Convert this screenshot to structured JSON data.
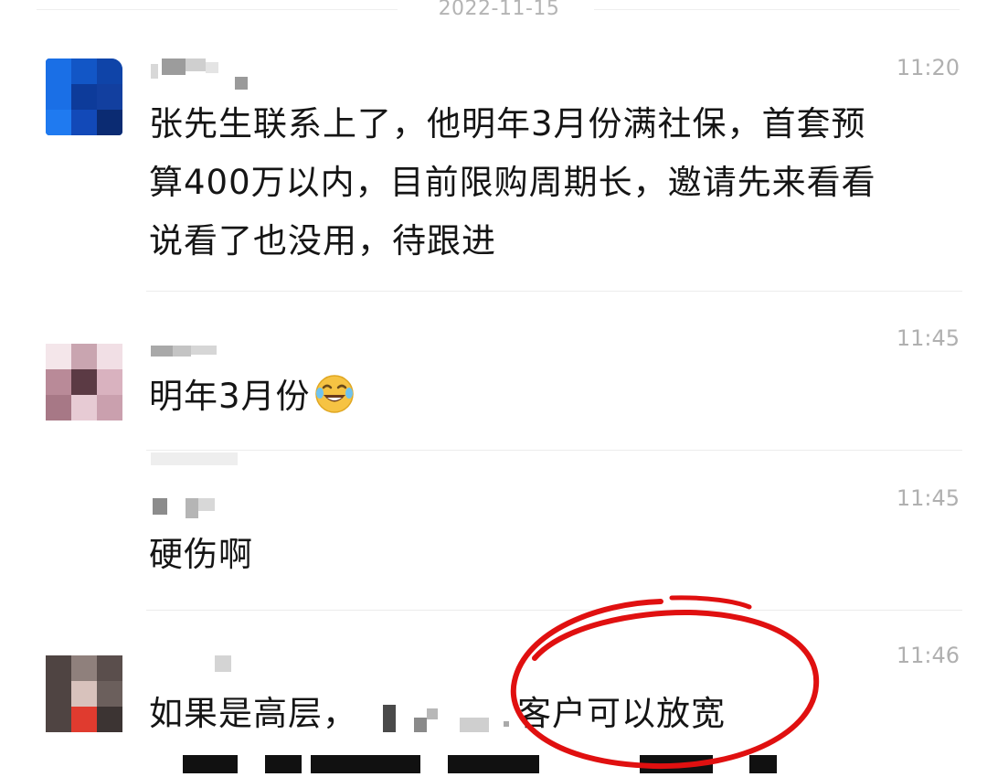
{
  "date_divider": "2022-11-15",
  "messages": [
    {
      "time": "11:20",
      "text": "张先生联系上了，他明年3月份满社保，首套预\n算400万以内，目前限购周期长，邀请先来看看\n说看了也没用，待跟进"
    },
    {
      "time": "11:45",
      "text": "明年3月份"
    },
    {
      "time": "11:45",
      "text": "硬伤啊"
    },
    {
      "time": "11:46",
      "text_before": "如果是高层，",
      "text_after": "客户可以放宽"
    }
  ],
  "icons": {
    "emoji": "tears-of-joy-emoji-icon",
    "annotation": "red-circle-annotation"
  },
  "colors": {
    "timestamp": "#b0b0b0",
    "text": "#151515",
    "annotation_red": "#e01010"
  }
}
